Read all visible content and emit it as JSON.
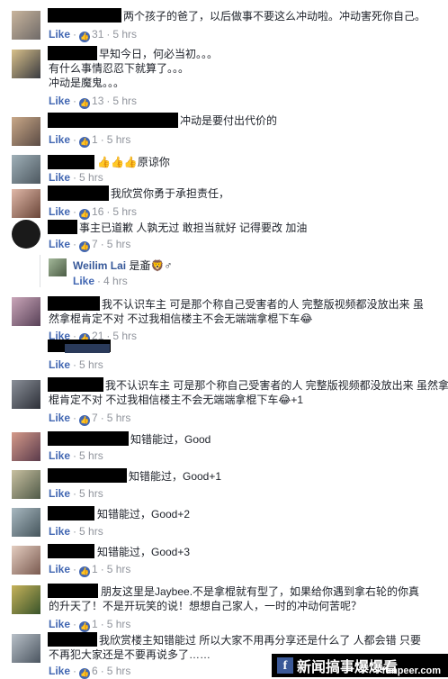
{
  "common": {
    "like": "Like",
    "time": "5 hrs",
    "time_4": "4 hrs",
    "dot": "·"
  },
  "comments": [
    {
      "text": "两个孩子的爸了，以后做事不要这么冲动啦。冲动害死你自己。",
      "likes": "31"
    },
    {
      "lines": [
        "早知今日，何必当初。。。",
        "有什么事情忍忍下就算了。。。",
        "冲动是魔鬼。。。"
      ],
      "likes": "13"
    },
    {
      "text": "冲动是要付出代价的",
      "likes": "1"
    },
    {
      "text": "👍👍👍原谅你"
    },
    {
      "text": "我欣赏你勇于承担责任，",
      "likes": "16"
    },
    {
      "text": "事主已道歉 人孰无过 敢担当就好 记得要改 加油",
      "likes": "7"
    },
    {
      "name": "Weilim Lai",
      "text": "是齑",
      "emoji": "🦁♂",
      "time": "4 hrs"
    },
    {
      "lines": [
        "我不认识车主 可是那个称自己受害者的人 完整版视频都没放出来 虽",
        "然拿棍肯定不对 不过我相信楼主不会无端端拿棍下车😂"
      ],
      "likes": "21"
    },
    {
      "text": ""
    },
    {
      "lines": [
        "我不认识车主 可是那个称自己受害者的人 完整版视频都没放出来 虽然拿",
        "棍肯定不对 不过我相信楼主不会无端端拿棍下车😂+1"
      ],
      "likes": "7"
    },
    {
      "text": "知错能过，Good"
    },
    {
      "text": "知错能过，Good+1"
    },
    {
      "text": "知错能过，Good+2"
    },
    {
      "text": "知错能过，Good+3",
      "likes": "1"
    },
    {
      "lines": [
        "朋友这里是Jaybee.不是拿棍就有型了，如果给你遇到拿右轮的你真",
        "的升天了！不是开玩笑的说！想想自己家人，一时的冲动何苦呢？"
      ],
      "likes": "1"
    },
    {
      "lines": [
        "我欣赏楼主知错能过 所以大家不用再分享还是什么了 人都会错 只要",
        "不再犯大家还是不要再说多了……"
      ],
      "likes": "6"
    }
  ],
  "footer": {
    "fb": "f",
    "title": "新闻搞事爆爆看",
    "url": "funpeer.com"
  },
  "colors": {
    "like_blue": "#4267b2",
    "meta_gray": "#90949c",
    "name_blue": "#365899"
  }
}
